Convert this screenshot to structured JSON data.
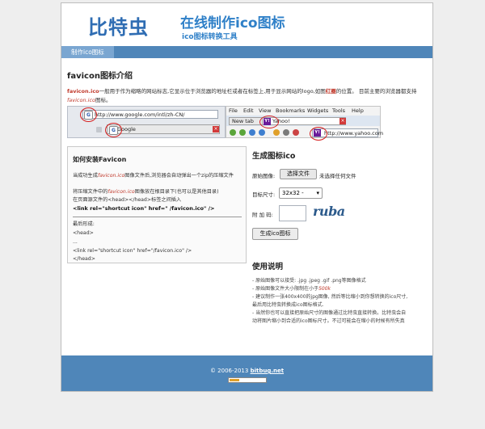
{
  "header": {
    "logo": "比特虫",
    "title": "在线制作ico图标",
    "subtitle": "ico图标转换工具"
  },
  "nav": {
    "tab_label": "制作ico图标"
  },
  "intro": {
    "title": "favicon图标介绍",
    "text_bold": "favicon.ico",
    "text_1": "一般用于作为缩略的网站标志,它显示位于浏览器的地址栏或者在标签上,用于显示网站的logo,如图",
    "text_red": "红圈",
    "text_2": "的位置。 目前主要的浏览器都支持",
    "text_italic": "favicon.ico",
    "text_3": "图标。"
  },
  "browser_shot_left": {
    "url": "http://www.google.com/intl/zh-CN/",
    "tab_label": "Google",
    "favicon_letter": "G"
  },
  "browser_shot_right": {
    "menu": [
      "File",
      "Edit",
      "View",
      "Bookmarks",
      "Widgets",
      "Tools",
      "Help"
    ],
    "tab_new": "New tab",
    "tab_yahoo": "Yahoo!",
    "url": "http://www.yahoo.com",
    "yahoo_letter": "Y!"
  },
  "install": {
    "title": "如何安装Favicon",
    "line1_a": "当成功生成",
    "line1_i": "favicon.ico",
    "line1_b": "图像文件后,浏览器会自动弹出一个zip的压缩文件",
    "line2_a": "将压缩文件中的",
    "line2_i": "favicon.ico",
    "line2_b": "图像放在根目录下(也可以是其他目录)",
    "line3": "在页面源文件的<head></head>标签之间插入",
    "code_main": "<link rel=\"shortcut icon\" href=\" /favicon.ico\" />",
    "final_label": "最后形成:",
    "head_open": "<head>",
    "ellipsis": "...",
    "link_line": "<link rel=\"shortcut icon\" href=\"/favicon.ico\" />",
    "head_close": "</head>"
  },
  "generate": {
    "title": "生成图标ico",
    "source_label": "原始图像:",
    "file_button": "选择文件",
    "file_status": "未选择任何文件",
    "size_label": "目标尺寸:",
    "size_value": "32x32 -",
    "captcha_label": "附 加 码:",
    "captcha_text": "ruba",
    "submit": "生成ico图标"
  },
  "usage": {
    "title": "使用说明",
    "items": [
      "- 原始图像可以接受: .jpg .jpeg .gif .png等图像格式",
      "- 原始图像文件大小限制在小于",
      "- 建议制作一张400x400的jpg图像, 然后等比缩小到你想转换的ico尺寸,最后用比特虫转换成ico图标格式.",
      "- 当然你也可以直接把原始尺寸的图像通过比特虫直接转换。比特虫会自动将图片缩小到合适的ico图标尺寸。不过可能会在缩小的时候有所失真"
    ],
    "size_limit": "500k"
  },
  "footer": {
    "copyright": "© 2006-2013",
    "link": "bitbug.net"
  },
  "colors": {
    "brand_blue": "#2f6db3",
    "nav_blue": "#4f86b9",
    "highlight_red": "#c0392b"
  }
}
